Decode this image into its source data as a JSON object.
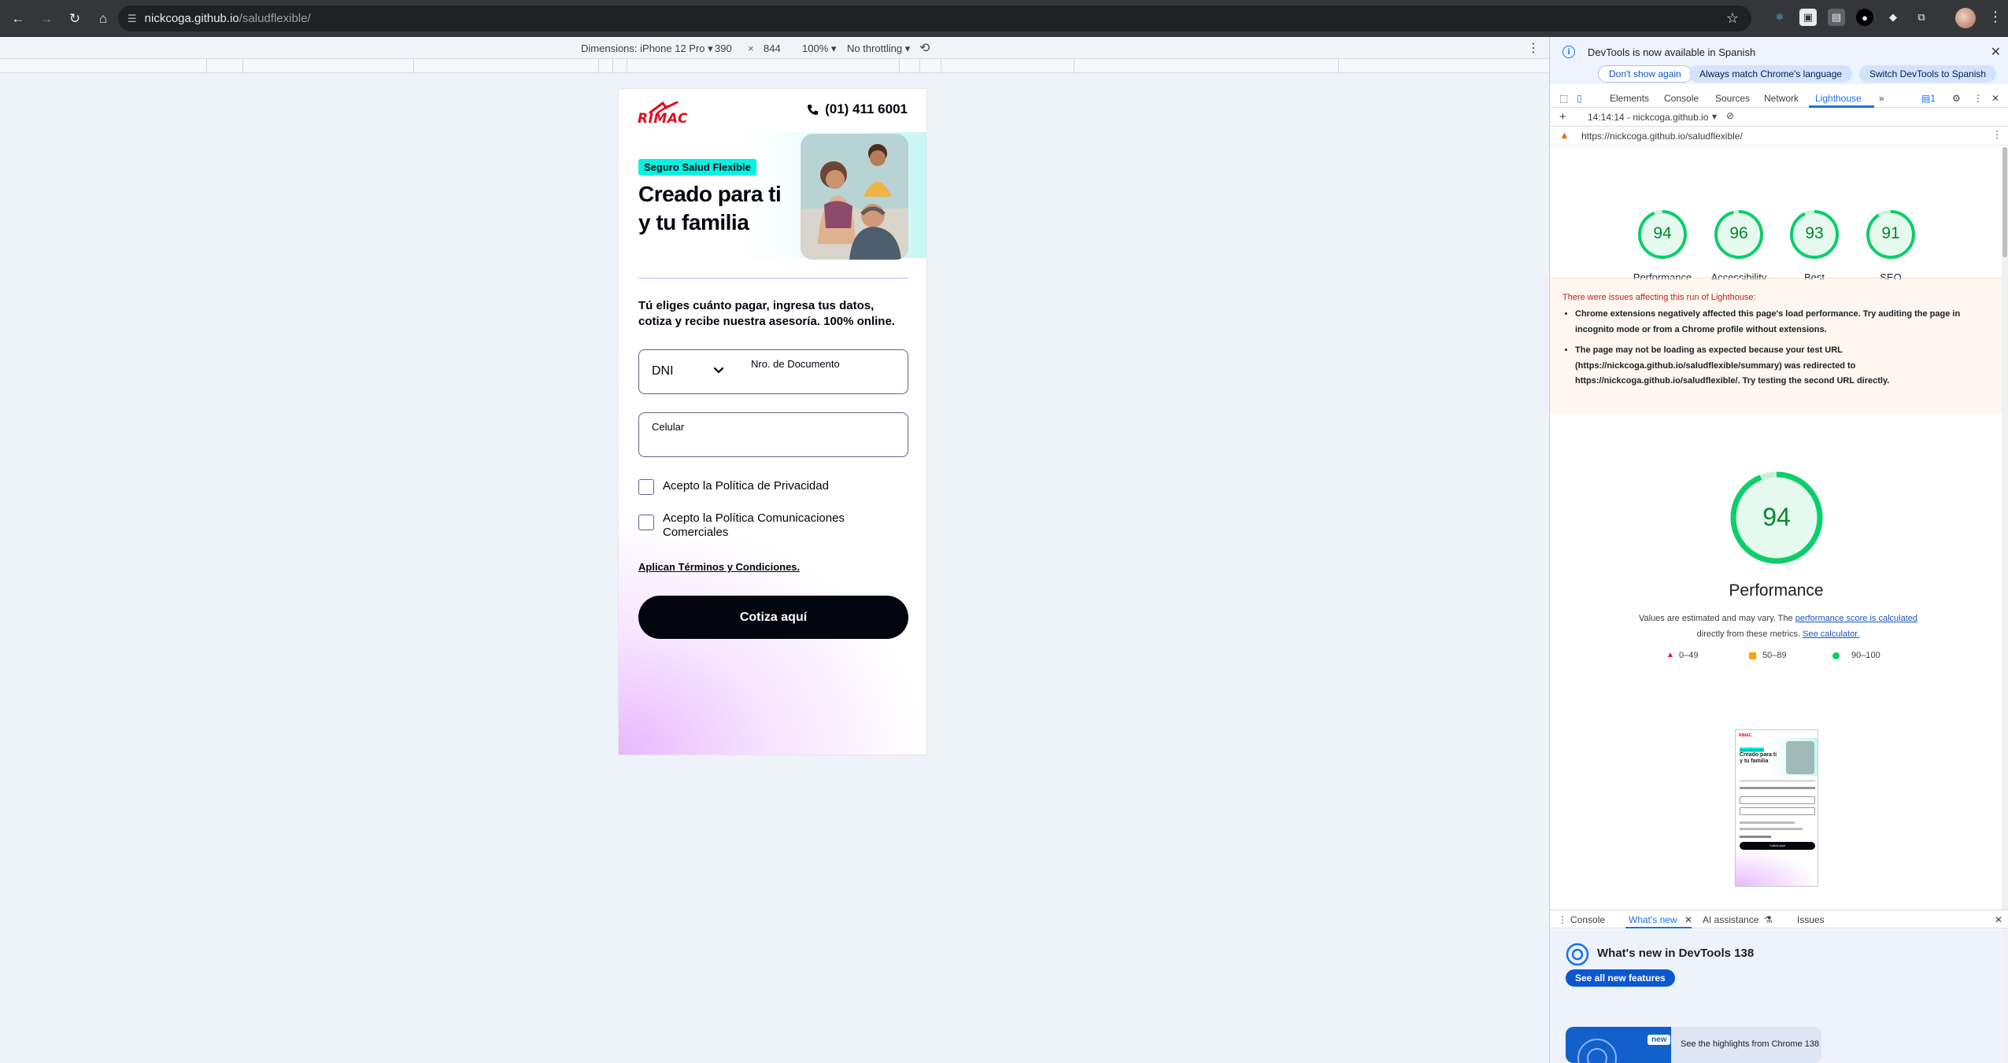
{
  "browser": {
    "url_host": "nickcoga.github.io",
    "url_path": "/saludflexible/"
  },
  "device_toolbar": {
    "dimensions_label": "Dimensions: iPhone 12 Pro ▾",
    "width": "390",
    "times": "×",
    "height": "844",
    "zoom": "100% ▾",
    "throttling": "No throttling ▾"
  },
  "page": {
    "logo_text": "RIMAC",
    "phone": "(01) 411 6001",
    "badge": "Seguro Salud Flexible",
    "title": "Creado para ti y tu familia",
    "description": "Tú eliges cuánto pagar, ingresa tus datos, cotiza y recibe nuestra asesoría. 100% online.",
    "doc_type": "DNI",
    "doc_label": "Nro. de Documento",
    "cel_label": "Celular",
    "privacy_label": "Acepto la Política de Privacidad",
    "comms_label": "Acepto la Política Comunicaciones Comerciales",
    "terms_link": "Aplican Términos y Condiciones.",
    "cta": "Cotiza aquí"
  },
  "devtools": {
    "banner": {
      "message": "DevTools is now available in Spanish",
      "dont_show": "Don't show again",
      "match_language": "Always match Chrome's language",
      "switch": "Switch DevTools to Spanish"
    },
    "tabs": [
      "Elements",
      "Console",
      "Sources",
      "Network",
      "Lighthouse"
    ],
    "issues_count": "1",
    "lighthouse_run": "14:14:14 - nickcoga.github.io",
    "report_url": "https://nickcoga.github.io/saludflexible/",
    "scores": [
      {
        "value": "94",
        "label": "Performance"
      },
      {
        "value": "96",
        "label": "Accessibility"
      },
      {
        "value": "93",
        "label": "Best Practices"
      },
      {
        "value": "91",
        "label": "SEO"
      }
    ],
    "warning_title": "There were issues affecting this run of Lighthouse:",
    "warning_1": "Chrome extensions negatively affected this page's load performance. Try auditing the page in incognito mode or from a Chrome profile without extensions.",
    "warning_2": "The page may not be loading as expected because your test URL (https://nickcoga.github.io/saludflexible/summary) was redirected to https://nickcoga.github.io/saludflexible/. Try testing the second URL directly.",
    "perf_score": "94",
    "perf_label": "Performance",
    "perf_note_1": "Values are estimated and may vary. The ",
    "perf_note_link1": "performance score is calculated",
    "perf_note_2": " directly from these metrics. ",
    "perf_note_link2": "See calculator.",
    "legend": {
      "red": "0–49",
      "orange": "50–89",
      "green": "90–100"
    },
    "thumb": {
      "badge": "Seguro Salud Flexible",
      "title": "Creado para ti y tu familia",
      "cta": "Cotiza aquí"
    },
    "drawer_tabs": [
      "Console",
      "What's new",
      "AI assistance",
      "Issues"
    ],
    "whats_new_title": "What's new in DevTools 138",
    "see_all": "See all new features",
    "new_badge": "new",
    "highlights": "See the highlights from Chrome 138"
  },
  "colors": {
    "brand_red": "#e2091e",
    "badge_teal": "#00f4e2",
    "cta_dark": "#03050f",
    "score_green": "#0cce6b"
  }
}
